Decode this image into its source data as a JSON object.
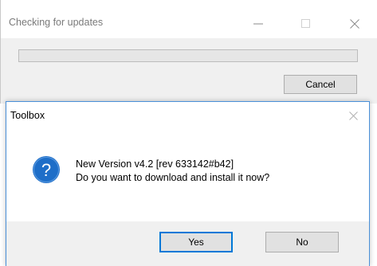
{
  "update_window": {
    "title": "Checking for updates",
    "progress": 0,
    "cancel_label": "Cancel",
    "icons": [
      "minimize-icon",
      "maximize-icon",
      "close-icon"
    ]
  },
  "dialog": {
    "title": "Toolbox",
    "line1": "New Version v4.2 [rev 633142#b42]",
    "line2": "Do you want to download and install it now?",
    "yes_label": "Yes",
    "no_label": "No",
    "icon": "question-icon"
  },
  "colors": {
    "accent": "#0078d7",
    "question_icon": "#1e6ec8",
    "dialog_border": "#4a90d9"
  }
}
